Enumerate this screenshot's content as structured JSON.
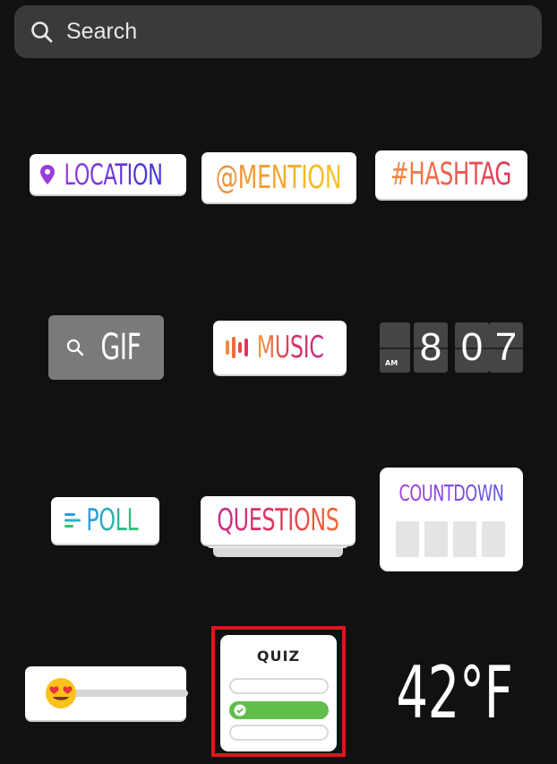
{
  "search": {
    "placeholder": "Search",
    "icon": "search-icon"
  },
  "stickers": {
    "location": "LOCATION",
    "mention": "@MENTION",
    "hashtag": "#HASHTAG",
    "gif": "GIF",
    "music": "MUSIC",
    "time": {
      "ampm": "AM",
      "d1": "8",
      "d2": "0",
      "d3": "7"
    },
    "poll": "POLL",
    "questions": "QUESTIONS",
    "countdown": "COUNTDOWN",
    "quiz": "QUIZ",
    "temperature": "42°F"
  },
  "selection_color": "#e0141e"
}
